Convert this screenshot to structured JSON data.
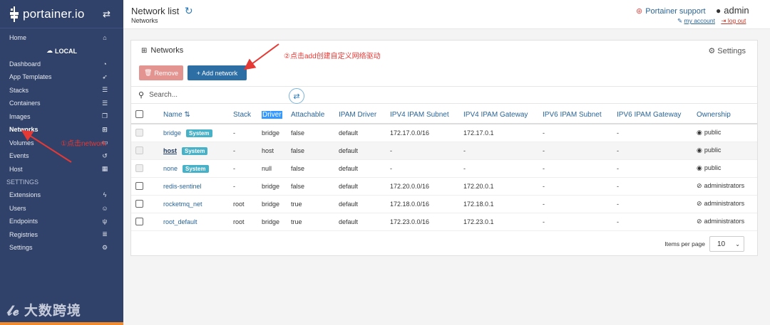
{
  "sidebar": {
    "brand": "portainer.io",
    "home": "Home",
    "endpoint": "LOCAL",
    "items": [
      {
        "label": "Dashboard",
        "icon": "tachometer-icon"
      },
      {
        "label": "App Templates",
        "icon": "rocket-icon"
      },
      {
        "label": "Stacks",
        "icon": "list-icon"
      },
      {
        "label": "Containers",
        "icon": "list-icon"
      },
      {
        "label": "Images",
        "icon": "clone-icon"
      },
      {
        "label": "Networks",
        "icon": "sitemap-icon"
      },
      {
        "label": "Volumes",
        "icon": "hdd-icon"
      },
      {
        "label": "Events",
        "icon": "history-icon"
      },
      {
        "label": "Host",
        "icon": "th-icon"
      }
    ],
    "settings_header": "SETTINGS",
    "settings_items": [
      {
        "label": "Extensions",
        "icon": "bolt-icon"
      },
      {
        "label": "Users",
        "icon": "users-icon"
      },
      {
        "label": "Endpoints",
        "icon": "plug-icon"
      },
      {
        "label": "Registries",
        "icon": "database-icon"
      },
      {
        "label": "Settings",
        "icon": "cogs-icon"
      }
    ],
    "watermark": "大数跨境"
  },
  "header": {
    "title": "Network list",
    "breadcrumb": "Networks",
    "support": "Portainer support",
    "user": "admin",
    "my_account": "my account",
    "log_out": "log out"
  },
  "panel": {
    "title": "Networks",
    "settings": "Settings",
    "remove": "Remove",
    "add": "+ Add network",
    "search_placeholder": "Search..."
  },
  "table": {
    "columns": [
      "Name",
      "Stack",
      "Driver",
      "Attachable",
      "IPAM Driver",
      "IPV4 IPAM Subnet",
      "IPV4 IPAM Gateway",
      "IPV6 IPAM Subnet",
      "IPV6 IPAM Gateway",
      "Ownership"
    ],
    "rows": [
      {
        "name": "bridge",
        "system": "System",
        "stack": "-",
        "driver": "bridge",
        "attachable": "false",
        "ipam": "default",
        "v4sub": "172.17.0.0/16",
        "v4gw": "172.17.0.1",
        "v6sub": "-",
        "v6gw": "-",
        "own": "public"
      },
      {
        "name": "host",
        "system": "System",
        "stack": "-",
        "driver": "host",
        "attachable": "false",
        "ipam": "default",
        "v4sub": "-",
        "v4gw": "-",
        "v6sub": "-",
        "v6gw": "-",
        "own": "public"
      },
      {
        "name": "none",
        "system": "System",
        "stack": "-",
        "driver": "null",
        "attachable": "false",
        "ipam": "default",
        "v4sub": "-",
        "v4gw": "-",
        "v6sub": "-",
        "v6gw": "-",
        "own": "public"
      },
      {
        "name": "redis-sentinel",
        "system": "",
        "stack": "-",
        "driver": "bridge",
        "attachable": "false",
        "ipam": "default",
        "v4sub": "172.20.0.0/16",
        "v4gw": "172.20.0.1",
        "v6sub": "-",
        "v6gw": "-",
        "own": "administrators"
      },
      {
        "name": "rocketmq_net",
        "system": "",
        "stack": "root",
        "driver": "bridge",
        "attachable": "true",
        "ipam": "default",
        "v4sub": "172.18.0.0/16",
        "v4gw": "172.18.0.1",
        "v6sub": "-",
        "v6gw": "-",
        "own": "administrators"
      },
      {
        "name": "root_default",
        "system": "",
        "stack": "root",
        "driver": "bridge",
        "attachable": "true",
        "ipam": "default",
        "v4sub": "172.23.0.0/16",
        "v4gw": "172.23.0.1",
        "v6sub": "-",
        "v6gw": "-",
        "own": "administrators"
      }
    ]
  },
  "pager": {
    "label": "Items per page",
    "value": "10"
  },
  "annotations": {
    "step1": "①点击network",
    "step2": "②点击add创建自定义网络驱动"
  }
}
